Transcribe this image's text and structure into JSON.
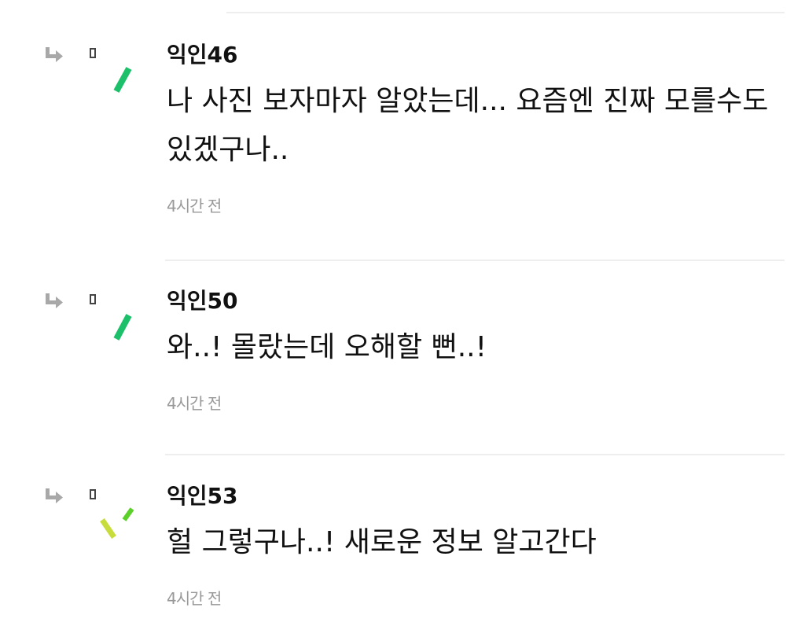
{
  "comments": [
    {
      "author": "익인46",
      "text": "나 사진 보자마자 알았는데... 요즘엔 진짜 모를수도 있겠구나..",
      "time": "4시간 전"
    },
    {
      "author": "익인50",
      "text": "와..! 몰랐는데 오해할 뻔..!",
      "time": "4시간 전"
    },
    {
      "author": "익인53",
      "text": "헐 그렇구나..! 새로운 정보 알고간다",
      "time": "4시간 전"
    }
  ],
  "colors": {
    "accent_green": "#1cc06a",
    "accent_lime": "#c8dc3c",
    "accent_lightgreen": "#5cd02a",
    "reply_icon": "#a8a8a8",
    "timestamp": "#999999",
    "divider": "#eeeeee"
  },
  "icons": {
    "reply": "reply-arrow-icon",
    "avatar": "anonymous-avatar-icon"
  }
}
